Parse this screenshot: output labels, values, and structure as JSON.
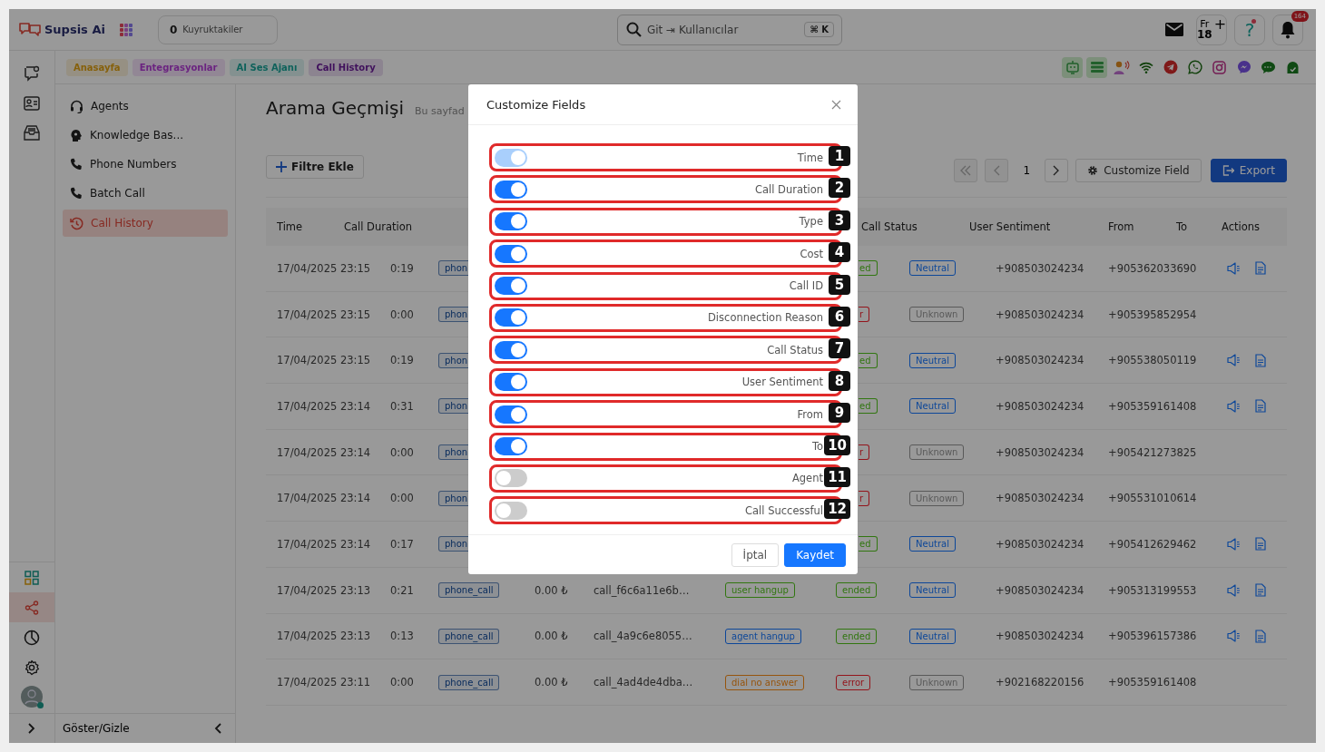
{
  "app": {
    "name": "Supsis Ai"
  },
  "queue": {
    "count": "0",
    "label": "Kuyruktakiler"
  },
  "search": {
    "value": "Git ⇥ Kullanıcılar",
    "shortcut": "⌘ K"
  },
  "calendar": {
    "day": "Fr",
    "date": "18",
    "action": "+"
  },
  "help": {
    "label": "?"
  },
  "notifications": {
    "count": "164"
  },
  "rail": {
    "top": [
      {
        "kind": "chat",
        "selected": false
      },
      {
        "kind": "contacts",
        "selected": false
      },
      {
        "kind": "inbox",
        "selected": false
      }
    ],
    "bottom": [
      {
        "kind": "grid",
        "selected": false
      },
      {
        "kind": "share",
        "selected": true
      },
      {
        "kind": "clock",
        "selected": false
      },
      {
        "kind": "settings",
        "selected": false
      }
    ]
  },
  "breadcrumbs": [
    {
      "label": "Anasayfa",
      "color": "#86600a"
    },
    {
      "label": "Entegrasyonlar",
      "color": "#6b2380"
    },
    {
      "label": "AI Ses Ajanı",
      "color": "#0e625b"
    },
    {
      "label": "Call History",
      "color": "#40105c"
    }
  ],
  "channels": [
    {
      "kind": "bot"
    },
    {
      "kind": "list"
    },
    {
      "kind": "voice"
    },
    {
      "kind": "wifi"
    },
    {
      "kind": "telegram"
    },
    {
      "kind": "whatsapp"
    },
    {
      "kind": "instagram"
    },
    {
      "kind": "messenger"
    },
    {
      "kind": "sms"
    },
    {
      "kind": "other"
    }
  ],
  "sidebar": {
    "items": [
      {
        "label": "Agents",
        "kind": "headset",
        "selected": false
      },
      {
        "label": "Knowledge Bas...",
        "kind": "brain",
        "selected": false
      },
      {
        "label": "Phone Numbers",
        "kind": "phone",
        "selected": false
      },
      {
        "label": "Batch Call",
        "kind": "phone",
        "selected": false
      },
      {
        "label": "Call History",
        "kind": "history",
        "selected": true
      }
    ],
    "footer": "Göster/Gizle"
  },
  "page": {
    "title": "Arama Geçmişi",
    "subtitle": "Bu sayfad",
    "filter_button": "Filtre Ekle"
  },
  "pagination": {
    "page": "1"
  },
  "toolbar": {
    "customize": "Customize Field",
    "export": "Export"
  },
  "table": {
    "columns": [
      "Time",
      "Call Duration",
      "Call Status",
      "User Sentiment",
      "From",
      "To",
      "Actions"
    ],
    "rows": [
      {
        "covered": true,
        "time": "17/04/2025 23:15",
        "duration": "0:19",
        "type": "phon",
        "status": {
          "label": "ed",
          "color": "#317610"
        },
        "sentiment": {
          "label": "Neutral",
          "color": "#0d4799"
        },
        "from": "+908503024234",
        "to": "+905362033690",
        "actions": true
      },
      {
        "covered": true,
        "time": "17/04/2025 23:15",
        "duration": "0:00",
        "type": "phon",
        "status": {
          "label": "r",
          "color": "#93141b"
        },
        "sentiment": {
          "label": "Unknown",
          "color": "#595959"
        },
        "from": "+908503024234",
        "to": "+905395852954",
        "actions": false
      },
      {
        "covered": true,
        "time": "17/04/2025 23:15",
        "duration": "0:19",
        "type": "phon",
        "status": {
          "label": "ed",
          "color": "#317610"
        },
        "sentiment": {
          "label": "Neutral",
          "color": "#0d4799"
        },
        "from": "+908503024234",
        "to": "+905538050119",
        "actions": true
      },
      {
        "covered": true,
        "time": "17/04/2025 23:14",
        "duration": "0:31",
        "type": "phon",
        "status": {
          "label": "ed",
          "color": "#317610"
        },
        "sentiment": {
          "label": "Neutral",
          "color": "#0d4799"
        },
        "from": "+908503024234",
        "to": "+905359161408",
        "actions": true
      },
      {
        "covered": true,
        "time": "17/04/2025 23:14",
        "duration": "0:00",
        "type": "phon",
        "status": {
          "label": "r",
          "color": "#93141b"
        },
        "sentiment": {
          "label": "Unknown",
          "color": "#595959"
        },
        "from": "+908503024234",
        "to": "+905421273825",
        "actions": false
      },
      {
        "covered": true,
        "time": "17/04/2025 23:14",
        "duration": "0:00",
        "type": "phon",
        "status": {
          "label": "r",
          "color": "#93141b"
        },
        "sentiment": {
          "label": "Unknown",
          "color": "#595959"
        },
        "from": "+908503024234",
        "to": "+905531010614",
        "actions": false
      },
      {
        "covered": true,
        "time": "17/04/2025 23:14",
        "duration": "0:17",
        "type": "phon",
        "status": {
          "label": "ed",
          "color": "#317610"
        },
        "sentiment": {
          "label": "Neutral",
          "color": "#0d4799"
        },
        "from": "+908503024234",
        "to": "+905412629462",
        "actions": true
      },
      {
        "covered": false,
        "time": "17/04/2025 23:13",
        "duration": "0:21",
        "type": "phone_call",
        "cost": "0.00 ₺",
        "call_id": "call_f6c6a11e6b…",
        "reason": {
          "label": "user hangup",
          "color": "#317610"
        },
        "status": {
          "label": "ended",
          "color": "#317610"
        },
        "sentiment": {
          "label": "Neutral",
          "color": "#0d4799"
        },
        "from": "+908503024234",
        "to": "+905313199553",
        "actions": true
      },
      {
        "covered": false,
        "time": "17/04/2025 23:13",
        "duration": "0:13",
        "type": "phone_call",
        "cost": "0.00 ₺",
        "call_id": "call_4a9c6e8055…",
        "reason": {
          "label": "agent hangup",
          "color": "#0d4799"
        },
        "status": {
          "label": "ended",
          "color": "#317610"
        },
        "sentiment": {
          "label": "Neutral",
          "color": "#0d4799"
        },
        "from": "+908503024234",
        "to": "+905396157386",
        "actions": true
      },
      {
        "covered": false,
        "time": "17/04/2025 23:11",
        "duration": "0:00",
        "type": "phone_call",
        "cost": "0.00 ₺",
        "call_id": "call_4ad4de4dba…",
        "reason": {
          "label": "dial no answer",
          "color": "#96540d"
        },
        "status": {
          "label": "error",
          "color": "#93141b"
        },
        "sentiment": {
          "label": "Unknown",
          "color": "#595959"
        },
        "from": "+902168220156",
        "to": "+905359161408",
        "actions": false
      }
    ]
  },
  "modal": {
    "title": "Customize Fields",
    "cancel": "İptal",
    "save": "Kaydet",
    "fields": [
      {
        "label": "Time",
        "on": true,
        "disabled": true,
        "badge": "1"
      },
      {
        "label": "Call Duration",
        "on": true,
        "disabled": false,
        "badge": "2"
      },
      {
        "label": "Type",
        "on": true,
        "disabled": false,
        "badge": "3"
      },
      {
        "label": "Cost",
        "on": true,
        "disabled": false,
        "badge": "4"
      },
      {
        "label": "Call ID",
        "on": true,
        "disabled": false,
        "badge": "5"
      },
      {
        "label": "Disconnection Reason",
        "on": true,
        "disabled": false,
        "badge": "6"
      },
      {
        "label": "Call Status",
        "on": true,
        "disabled": false,
        "badge": "7"
      },
      {
        "label": "User Sentiment",
        "on": true,
        "disabled": false,
        "badge": "8"
      },
      {
        "label": "From",
        "on": true,
        "disabled": false,
        "badge": "9"
      },
      {
        "label": "To",
        "on": true,
        "disabled": false,
        "badge": "10"
      },
      {
        "label": "Agent",
        "on": false,
        "disabled": false,
        "badge": "11"
      },
      {
        "label": "Call Successful",
        "on": false,
        "disabled": false,
        "badge": "12"
      }
    ]
  }
}
